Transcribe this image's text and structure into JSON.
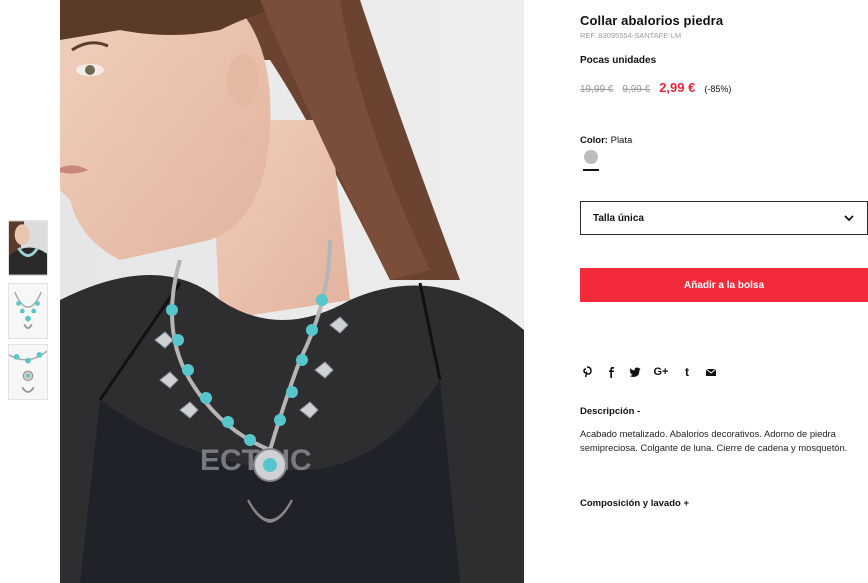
{
  "product": {
    "title": "Collar abalorios piedra",
    "ref": "REF. 83095554-SANTAFE-LM",
    "stock": "Pocas unidades",
    "old_price_1": "19,99 €",
    "old_price_2": "9,99 €",
    "price": "2,99 €",
    "discount": "(-85%)",
    "color_label": "Color:",
    "color_value": "Plata",
    "swatch_color": "#bdbdbd",
    "size": "Talla única",
    "add_button": "Añadir a la bolsa",
    "accent": "#f22a3a"
  },
  "share": {
    "icons": [
      "pinterest-icon",
      "facebook-icon",
      "twitter-icon",
      "google-plus-icon",
      "tumblr-icon",
      "mail-icon"
    ]
  },
  "description": {
    "heading": "Descripción  -",
    "body": "Acabado metalizado. Abalorios decorativos. Adorno de piedra semipreciosa. Colgante de luna. Cierre de cadena y mosquetón."
  },
  "composition": {
    "heading": "Composición y lavado  +"
  }
}
